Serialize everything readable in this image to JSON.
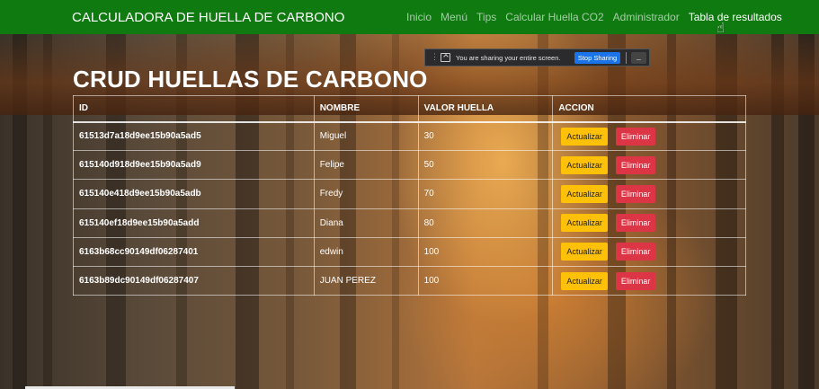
{
  "navbar": {
    "brand": "CALCULADORA DE HUELLA DE CARBONO",
    "links": [
      "Inicio",
      "Menú",
      "Tips",
      "Calcular Huella CO2",
      "Administrador",
      "Tabla de resultados"
    ],
    "active": "Tabla de resultados"
  },
  "share_bar": {
    "message": "You are sharing your entire screen.",
    "stop_label": "Stop Sharing",
    "hide_label": "_"
  },
  "page": {
    "title": "CRUD HUELLAS DE CARBONO"
  },
  "table": {
    "headers": [
      "ID",
      "NOMBRE",
      "VALOR HUELLA",
      "ACCION"
    ],
    "rows": [
      {
        "id": "61513d7a18d9ee15b90a5ad5",
        "nombre": "Miguel",
        "valor": "30"
      },
      {
        "id": "615140d918d9ee15b90a5ad9",
        "nombre": "Felipe",
        "valor": "50"
      },
      {
        "id": "615140e418d9ee15b90a5adb",
        "nombre": "Fredy",
        "valor": "70"
      },
      {
        "id": "615140ef18d9ee15b90a5add",
        "nombre": "Diana",
        "valor": "80"
      },
      {
        "id": "6163b68cc90149df06287401",
        "nombre": "edwin",
        "valor": "100"
      },
      {
        "id": "6163b89dc90149df06287407",
        "nombre": "JUAN PEREZ",
        "valor": "100"
      }
    ],
    "update_label": "Actualizar",
    "delete_label": "Eliminar"
  },
  "colors": {
    "navbar": "#0f7a10",
    "warning": "#ffc107",
    "danger": "#dc3545",
    "share_button": "#1a73e8"
  }
}
